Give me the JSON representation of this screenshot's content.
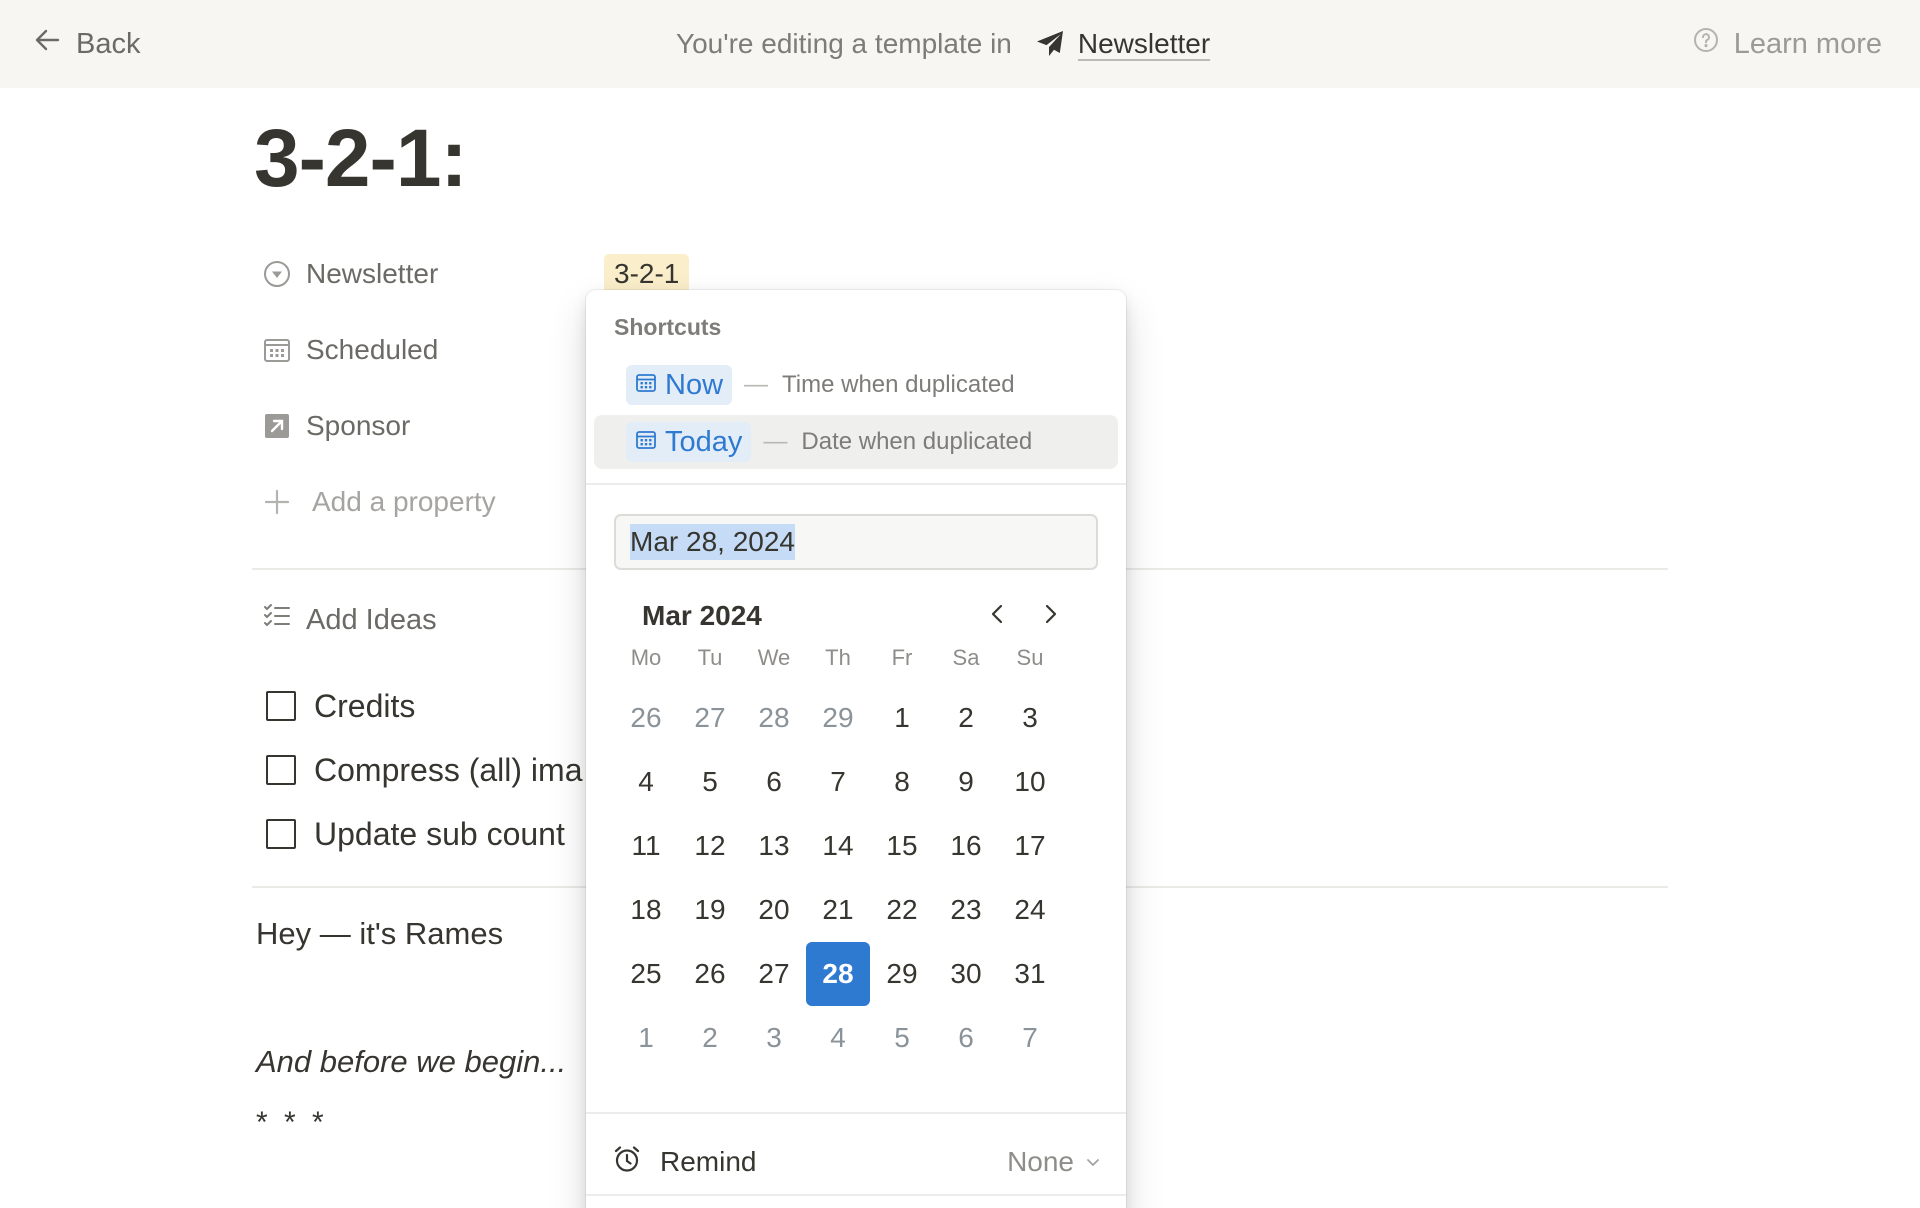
{
  "banner": {
    "back_label": "Back",
    "editing_text": "You're editing a template in",
    "database_name": "Newsletter",
    "learn_more_label": "Learn more"
  },
  "page": {
    "title": "3-2-1:"
  },
  "properties": [
    {
      "label": "Newsletter",
      "icon": "select-arrow-icon",
      "value": "3-2-1"
    },
    {
      "label": "Scheduled",
      "icon": "calendar-icon"
    },
    {
      "label": "Sponsor",
      "icon": "relation-arrow-icon"
    }
  ],
  "add_property_label": "Add a property",
  "ideas": {
    "heading": "Add Ideas",
    "todos": [
      "Credits",
      "Compress (all) ima",
      "Update sub count"
    ]
  },
  "body": {
    "greeting": "Hey — it's Rames",
    "before": "And before we begin...",
    "separator": "* * *"
  },
  "date_picker": {
    "shortcuts_title": "Shortcuts",
    "shortcuts": [
      {
        "chip": "Now",
        "dash": "—",
        "desc": "Time when duplicated"
      },
      {
        "chip": "Today",
        "dash": "—",
        "desc": "Date when duplicated"
      }
    ],
    "input_value": "Mar 28, 2024",
    "month_label": "Mar 2024",
    "weekdays": [
      "Mo",
      "Tu",
      "We",
      "Th",
      "Fr",
      "Sa",
      "Su"
    ],
    "weeks": [
      [
        "26",
        "27",
        "28",
        "29",
        "1",
        "2",
        "3"
      ],
      [
        "4",
        "5",
        "6",
        "7",
        "8",
        "9",
        "10"
      ],
      [
        "11",
        "12",
        "13",
        "14",
        "15",
        "16",
        "17"
      ],
      [
        "18",
        "19",
        "20",
        "21",
        "22",
        "23",
        "24"
      ],
      [
        "25",
        "26",
        "27",
        "28",
        "29",
        "30",
        "31"
      ],
      [
        "1",
        "2",
        "3",
        "4",
        "5",
        "6",
        "7"
      ]
    ],
    "selected_day": "28",
    "remind_label": "Remind",
    "remind_value": "None",
    "accent_color": "#2f7ad1"
  }
}
